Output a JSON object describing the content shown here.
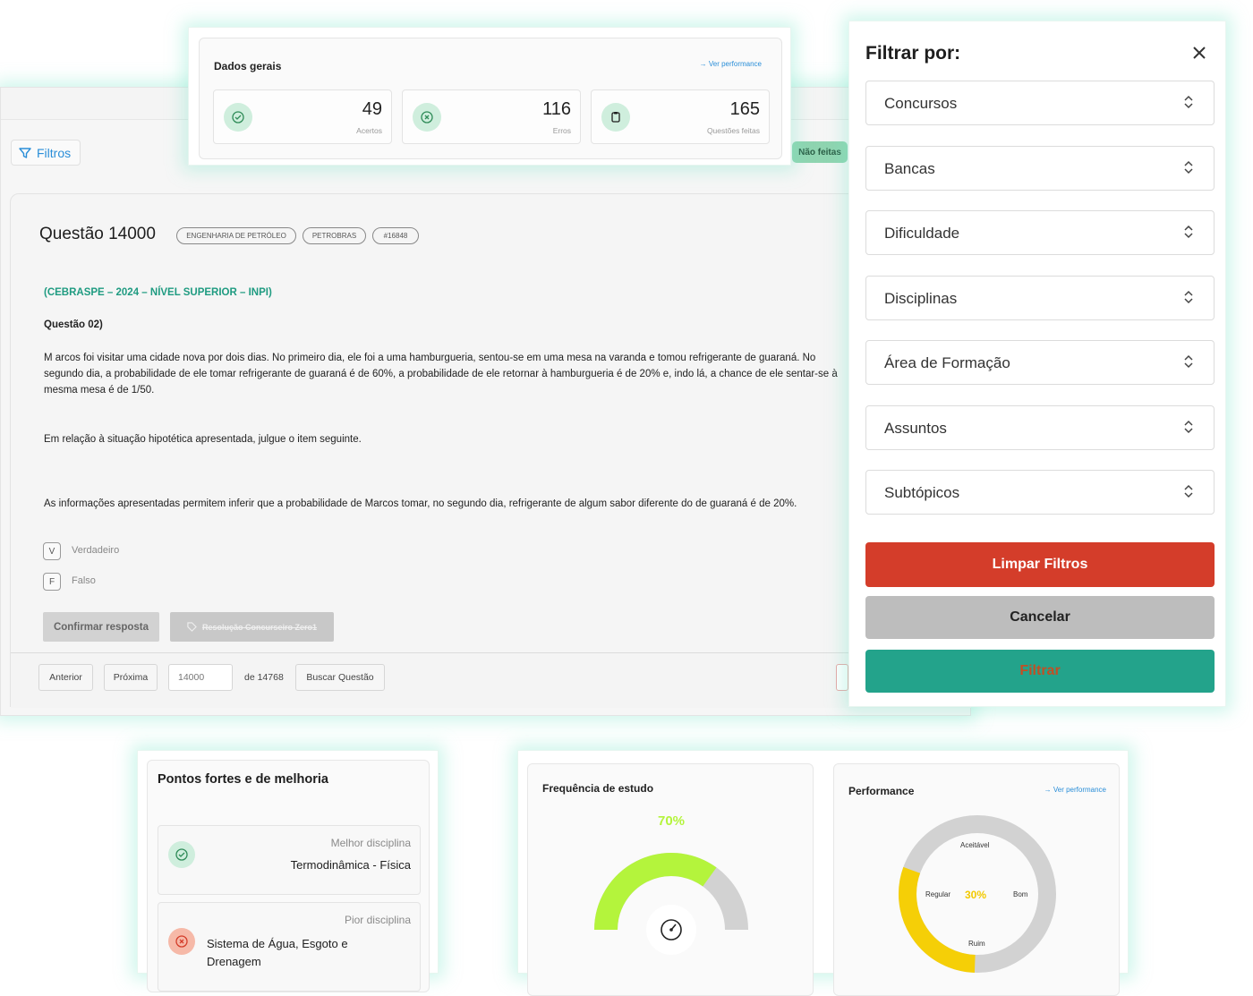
{
  "general": {
    "title": "Dados gerais",
    "link": "Ver performance",
    "stats": [
      {
        "value": "49",
        "label": "Acertos",
        "icon": "check-circle-icon"
      },
      {
        "value": "116",
        "label": "Erros",
        "icon": "x-circle-icon"
      },
      {
        "value": "165",
        "label": "Questões feitas",
        "icon": "clipboard-icon"
      }
    ]
  },
  "toolbar": {
    "filters_label": "Filtros",
    "not_done_badge": "Não feitas"
  },
  "question": {
    "title": "Questão 14000",
    "tags": [
      "ENGENHARIA DE PETRÓLEO",
      "PETROBRAS",
      "#16848"
    ],
    "source": "(CEBRASPE – 2024 – NÍVEL SUPERIOR – INPI)",
    "label": "Questão 02)",
    "paragraph1": "M arcos foi visitar uma cidade nova por dois dias. No primeiro dia, ele foi a uma hamburgueria, sentou-se em uma mesa na varanda e tomou refrigerante de guaraná. No segundo dia, a probabilidade de ele tomar refrigerante de guaraná é de 60%, a probabilidade de ele retornar à hamburgueria é de 20% e, indo lá, a chance de ele sentar-se à mesma mesa é de 1/50.",
    "paragraph2": "Em relação à situação hipotética apresentada, julgue o item seguinte.",
    "paragraph3": "As informações apresentadas permitem inferir que a probabilidade de Marcos tomar, no segundo dia, refrigerante de algum sabor diferente do de guaraná é de 20%.",
    "options": [
      {
        "letter": "V",
        "label": "Verdadeiro"
      },
      {
        "letter": "F",
        "label": "Falso"
      }
    ],
    "confirm_label": "Confirmar resposta",
    "resolution_label": "Resolução Concurseiro Zero1"
  },
  "navigation": {
    "prev_label": "Anterior",
    "next_label": "Próxima",
    "page_value": "14000",
    "total_label": "de 14768",
    "search_label": "Buscar Questão"
  },
  "filter_panel": {
    "title": "Filtrar por:",
    "selects": [
      "Concursos",
      "Bancas",
      "Dificuldade",
      "Disciplinas",
      "Área de Formação",
      "Assuntos",
      "Subtópicos"
    ],
    "clear_label": "Limpar Filtros",
    "cancel_label": "Cancelar",
    "apply_label": "Filtrar"
  },
  "strengths": {
    "title": "Pontos fortes e de melhoria",
    "best_caption": "Melhor disciplina",
    "best_name": "Termodinâmica - Física",
    "worst_caption": "Pior disciplina",
    "worst_name": "Sistema de Água, Esgoto e Drenagem"
  },
  "frequency": {
    "title": "Frequência de estudo",
    "percent_label": "70%",
    "value": 0.7
  },
  "performance": {
    "title": "Performance",
    "link": "Ver performance",
    "percent_label": "30%",
    "value": 0.3,
    "labels": {
      "top": "Aceitável",
      "left": "Regular",
      "right": "Bom",
      "bottom": "Ruim"
    }
  },
  "colors": {
    "accent_green": "#23a38b",
    "danger_red": "#d43d2a",
    "gauge_green": "#b4f43c",
    "gauge_yellow": "#f5cf07",
    "link_blue": "#2a8ed8"
  }
}
